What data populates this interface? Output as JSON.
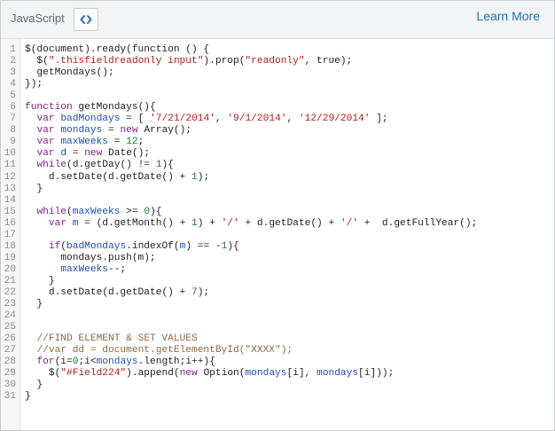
{
  "toolbar": {
    "language_label": "JavaScript",
    "toggle_icon": "code-brackets-icon",
    "learn_more_label": "Learn More"
  },
  "code_lines": [
    [
      [
        "p",
        "$(document).ready(function () {"
      ]
    ],
    [
      [
        "p",
        "  $("
      ],
      [
        "s",
        "\".thisfieldreadonly input\""
      ],
      [
        "p",
        ").prop("
      ],
      [
        "s",
        "\"readonly\""
      ],
      [
        "p",
        ", true);"
      ]
    ],
    [
      [
        "p",
        "  getMondays();"
      ]
    ],
    [
      [
        "p",
        "});"
      ]
    ],
    [
      [
        "p",
        ""
      ]
    ],
    [
      [
        "k",
        "function"
      ],
      [
        "p",
        " getMondays(){"
      ]
    ],
    [
      [
        "p",
        "  "
      ],
      [
        "k",
        "var"
      ],
      [
        "p",
        " "
      ],
      [
        "v",
        "badMondays"
      ],
      [
        "p",
        " = [ "
      ],
      [
        "s",
        "'7/21/2014'"
      ],
      [
        "p",
        ", "
      ],
      [
        "s",
        "'9/1/2014'"
      ],
      [
        "p",
        ", "
      ],
      [
        "s",
        "'12/29/2014'"
      ],
      [
        "p",
        " ];"
      ]
    ],
    [
      [
        "p",
        "  "
      ],
      [
        "k",
        "var"
      ],
      [
        "p",
        " "
      ],
      [
        "v",
        "mondays"
      ],
      [
        "p",
        " = "
      ],
      [
        "k",
        "new"
      ],
      [
        "p",
        " Array();"
      ]
    ],
    [
      [
        "p",
        "  "
      ],
      [
        "k",
        "var"
      ],
      [
        "p",
        " "
      ],
      [
        "v",
        "maxWeeks"
      ],
      [
        "p",
        " = "
      ],
      [
        "n",
        "12"
      ],
      [
        "p",
        ";"
      ]
    ],
    [
      [
        "p",
        "  "
      ],
      [
        "k",
        "var"
      ],
      [
        "p",
        " "
      ],
      [
        "v",
        "d"
      ],
      [
        "p",
        " = "
      ],
      [
        "k",
        "new"
      ],
      [
        "p",
        " Date();"
      ]
    ],
    [
      [
        "p",
        "  "
      ],
      [
        "k",
        "while"
      ],
      [
        "p",
        "(d.getDay() != "
      ],
      [
        "n",
        "1"
      ],
      [
        "p",
        "){"
      ]
    ],
    [
      [
        "p",
        "    d.setDate(d.getDate() + "
      ],
      [
        "n",
        "1"
      ],
      [
        "p",
        ");"
      ]
    ],
    [
      [
        "p",
        "  }"
      ]
    ],
    [
      [
        "p",
        ""
      ]
    ],
    [
      [
        "p",
        "  "
      ],
      [
        "k",
        "while"
      ],
      [
        "p",
        "("
      ],
      [
        "v",
        "maxWeeks"
      ],
      [
        "p",
        " >= "
      ],
      [
        "n",
        "0"
      ],
      [
        "p",
        "){"
      ]
    ],
    [
      [
        "p",
        "    "
      ],
      [
        "k",
        "var"
      ],
      [
        "p",
        " "
      ],
      [
        "v",
        "m"
      ],
      [
        "p",
        " = (d.getMonth() + "
      ],
      [
        "n",
        "1"
      ],
      [
        "p",
        ") + "
      ],
      [
        "s",
        "'/'"
      ],
      [
        "p",
        " + d.getDate() + "
      ],
      [
        "s",
        "'/'"
      ],
      [
        "p",
        " +  d.getFullYear();"
      ]
    ],
    [
      [
        "p",
        ""
      ]
    ],
    [
      [
        "p",
        "    "
      ],
      [
        "k",
        "if"
      ],
      [
        "p",
        "("
      ],
      [
        "v",
        "badMondays"
      ],
      [
        "p",
        ".indexOf("
      ],
      [
        "v",
        "m"
      ],
      [
        "p",
        ") == -"
      ],
      [
        "n",
        "1"
      ],
      [
        "p",
        "){"
      ]
    ],
    [
      [
        "p",
        "      mondays.push(m);"
      ]
    ],
    [
      [
        "p",
        "      "
      ],
      [
        "v",
        "maxWeeks"
      ],
      [
        "p",
        "--;"
      ]
    ],
    [
      [
        "p",
        "    }"
      ]
    ],
    [
      [
        "p",
        "    d.setDate(d.getDate() + "
      ],
      [
        "n",
        "7"
      ],
      [
        "p",
        ");"
      ]
    ],
    [
      [
        "p",
        "  }"
      ]
    ],
    [
      [
        "p",
        ""
      ]
    ],
    [
      [
        "p",
        ""
      ]
    ],
    [
      [
        "p",
        "  "
      ],
      [
        "c",
        "//FIND ELEMENT & SET VALUES"
      ]
    ],
    [
      [
        "p",
        "  "
      ],
      [
        "c",
        "//var dd = document.getElementById(\"XXXX\");"
      ]
    ],
    [
      [
        "p",
        "  "
      ],
      [
        "k",
        "for"
      ],
      [
        "p",
        "(i="
      ],
      [
        "n",
        "0"
      ],
      [
        "p",
        ";i<"
      ],
      [
        "v",
        "mondays"
      ],
      [
        "p",
        ".length;i++){"
      ]
    ],
    [
      [
        "p",
        "    $("
      ],
      [
        "s",
        "\"#Field224\""
      ],
      [
        "p",
        ").append("
      ],
      [
        "k",
        "new"
      ],
      [
        "p",
        " Option("
      ],
      [
        "v",
        "mondays"
      ],
      [
        "p",
        "[i], "
      ],
      [
        "v",
        "mondays"
      ],
      [
        "p",
        "[i]));"
      ]
    ],
    [
      [
        "p",
        "  }"
      ]
    ],
    [
      [
        "p",
        "}"
      ]
    ]
  ]
}
